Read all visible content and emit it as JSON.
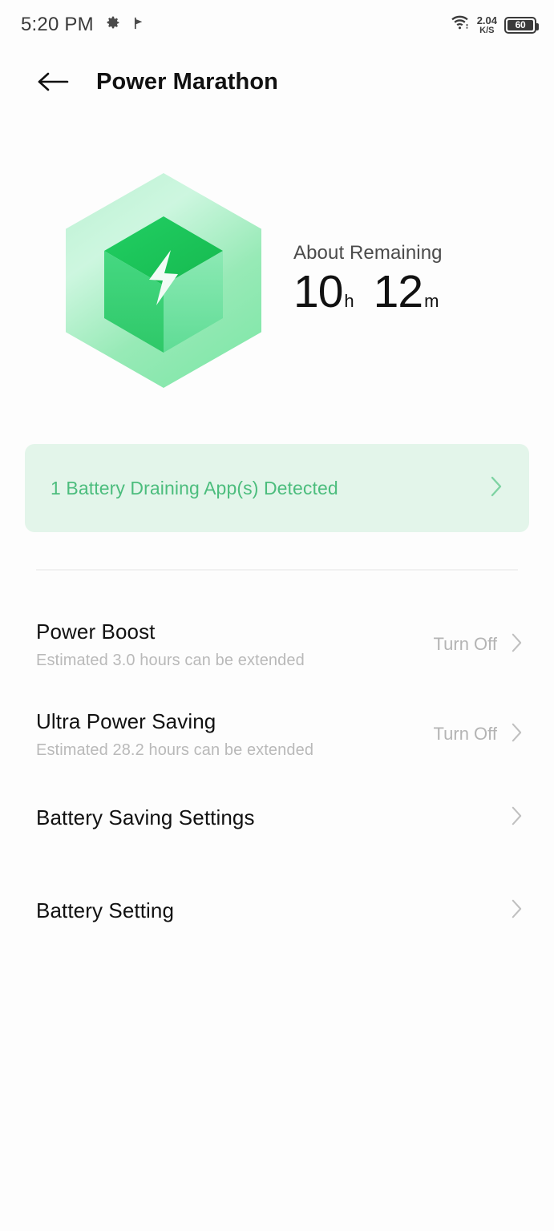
{
  "statusbar": {
    "time": "5:20 PM",
    "icons": [
      "gear-icon",
      "flag-icon"
    ],
    "network_speed_value": "2.04",
    "network_speed_unit": "K/S",
    "wifi": "wifi-icon",
    "battery_level": "60"
  },
  "header": {
    "back": "back-arrow-icon",
    "title": "Power Marathon"
  },
  "hero": {
    "icon": "battery-cube-icon",
    "label": "About Remaining",
    "hours": "10",
    "hours_unit": "h",
    "minutes": "12",
    "minutes_unit": "m"
  },
  "banner": {
    "text": "1 Battery Draining App(s) Detected",
    "chevron": "chevron-right-icon",
    "bg_color": "#e3f5ea",
    "text_color": "#4cbd7d"
  },
  "list": [
    {
      "title": "Power Boost",
      "subtitle": "Estimated 3.0 hours can be extended",
      "action": "Turn Off",
      "chevron": "chevron-right-icon"
    },
    {
      "title": "Ultra Power Saving",
      "subtitle": "Estimated 28.2 hours can be extended",
      "action": "Turn Off",
      "chevron": "chevron-right-icon"
    },
    {
      "title": "Battery Saving Settings",
      "subtitle": "",
      "action": "",
      "chevron": "chevron-right-icon"
    },
    {
      "title": "Battery Setting",
      "subtitle": "",
      "action": "",
      "chevron": "chevron-right-icon"
    }
  ]
}
